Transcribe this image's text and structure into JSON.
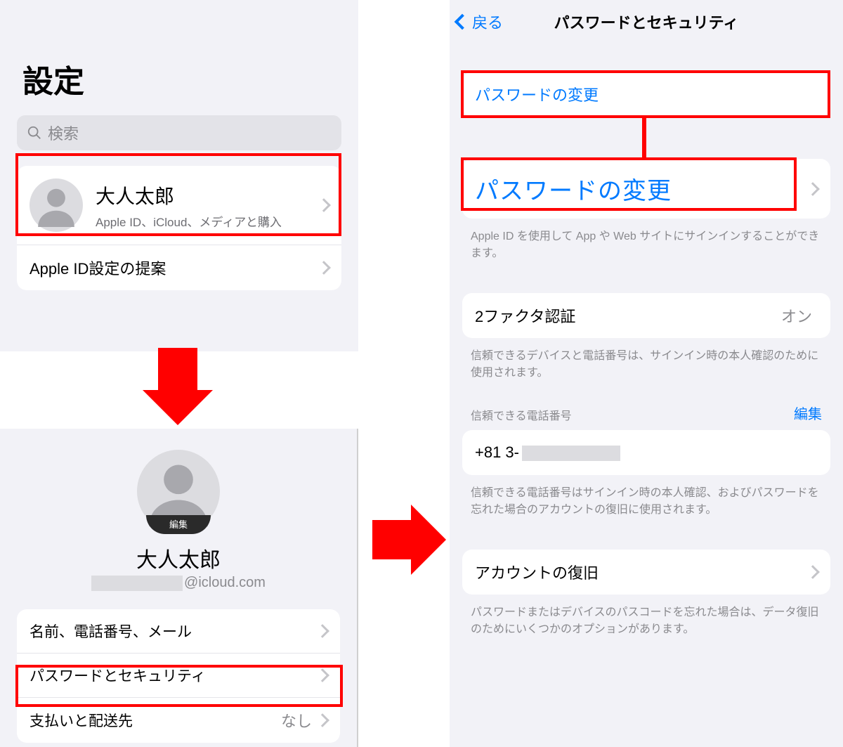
{
  "screen1": {
    "title": "設定",
    "search_placeholder": "検索",
    "profile": {
      "name": "大人太郎",
      "subtitle": "Apple ID、iCloud、メディアと購入"
    },
    "suggestion_row": "Apple ID設定の提案"
  },
  "screen2": {
    "avatar_edit": "編集",
    "name": "大人太郎",
    "email_suffix": "@icloud.com",
    "rows": {
      "name_phone_mail": "名前、電話番号、メール",
      "password_security": "パスワードとセキュリティ",
      "payment_shipping": "支払いと配送先",
      "payment_value": "なし"
    }
  },
  "screen3": {
    "back": "戻る",
    "title": "パスワードとセキュリティ",
    "change_password": "パスワードの変更",
    "change_password_callout": "パスワードの変更",
    "signin_with_apple_footer": "Apple ID を使用して App や Web サイトにサインインすることができます。",
    "two_factor": {
      "label": "2ファクタ認証",
      "value": "オン"
    },
    "two_factor_footer": "信頼できるデバイスと電話番号は、サインイン時の本人確認のために使用されます。",
    "trusted_header": "信頼できる電話番号",
    "trusted_edit": "編集",
    "trusted_phone_prefix": "+81 3-",
    "trusted_footer": "信頼できる電話番号はサインイン時の本人確認、およびパスワードを忘れた場合のアカウントの復旧に使用されます。",
    "recovery": "アカウントの復旧",
    "recovery_footer": "パスワードまたはデバイスのパスコードを忘れた場合は、データ復旧のためにいくつかのオプションがあります。"
  }
}
